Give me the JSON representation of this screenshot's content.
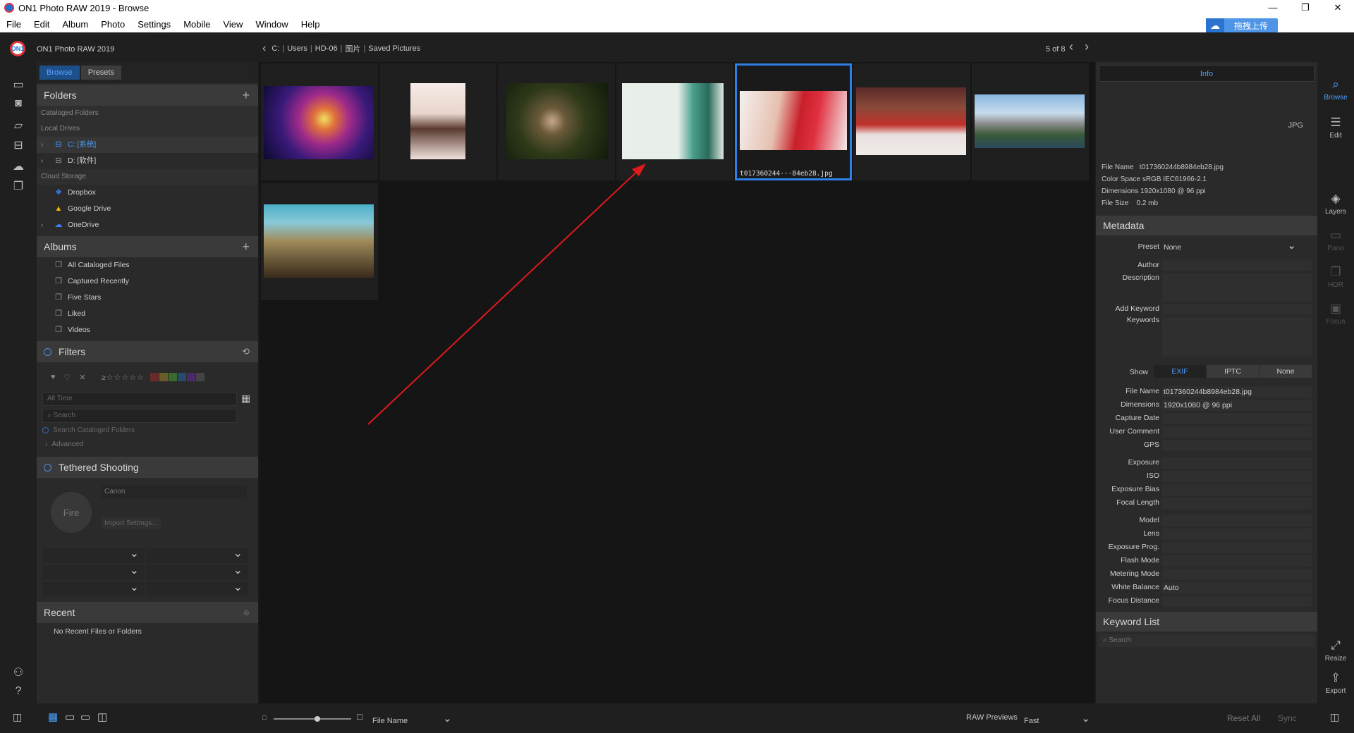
{
  "window": {
    "title": "ON1 Photo RAW 2019 - Browse",
    "controls": [
      "—",
      "❐",
      "✕"
    ]
  },
  "menu": [
    "File",
    "Edit",
    "Album",
    "Photo",
    "Settings",
    "Mobile",
    "View",
    "Window",
    "Help"
  ],
  "upload_button": "拖拽上传",
  "header": {
    "app_name": "ON1 Photo RAW 2019",
    "breadcrumb": [
      "C:",
      "Users",
      "HD-06",
      "图片",
      "Saved Pictures"
    ],
    "count": "5 of 8"
  },
  "left": {
    "tabs": [
      "Browse",
      "Presets"
    ],
    "folders": {
      "title": "Folders",
      "cataloged": "Cataloged Folders",
      "local": "Local Drives",
      "drives": [
        "C: [系统]",
        "D: [软件]"
      ],
      "cloud": "Cloud Storage",
      "cloud_items": [
        "Dropbox",
        "Google Drive",
        "OneDrive"
      ]
    },
    "albums": {
      "title": "Albums",
      "items": [
        "All Cataloged Files",
        "Captured Recently",
        "Five Stars",
        "Liked",
        "Videos"
      ]
    },
    "filters": {
      "title": "Filters",
      "stars": "≥☆☆☆☆☆",
      "time": "All Time",
      "search_placeholder": "Search",
      "search_cataloged": "Search Cataloged Folders",
      "advanced": "Advanced"
    },
    "tethered": {
      "title": "Tethered Shooting",
      "fire": "Fire",
      "camera": "Canon",
      "import": "Import Settings..."
    },
    "recent": {
      "title": "Recent",
      "empty": "No Recent Files or Folders"
    }
  },
  "grid": {
    "selected_name": "t017360244···84eb28.jpg"
  },
  "right": {
    "info_tab": "Info",
    "format": "JPG",
    "file_info": [
      {
        "k": "File Name",
        "v": "t017360244b8984eb28.jpg"
      },
      {
        "k": "Color Space",
        "v": "sRGB IEC61966-2.1"
      },
      {
        "k": "Dimensions",
        "v": "1920x1080 @ 96 ppi"
      },
      {
        "k": "File Size",
        "v": "0.2 mb"
      }
    ],
    "metadata": {
      "title": "Metadata",
      "preset_label": "Preset",
      "preset_value": "None",
      "author": "Author",
      "description": "Description",
      "add_keyword": "Add Keyword",
      "keywords": "Keywords",
      "show_label": "Show",
      "show_options": [
        "EXIF",
        "IPTC",
        "None"
      ],
      "exif": [
        {
          "k": "File Name",
          "v": "t017360244b8984eb28.jpg"
        },
        {
          "k": "Dimensions",
          "v": "1920x1080 @ 96 ppi"
        },
        {
          "k": "Capture Date",
          "v": ""
        },
        {
          "k": "User Comment",
          "v": ""
        },
        {
          "k": "GPS",
          "v": ""
        },
        {
          "k": "Exposure",
          "v": ""
        },
        {
          "k": "ISO",
          "v": ""
        },
        {
          "k": "Exposure Bias",
          "v": ""
        },
        {
          "k": "Focal Length",
          "v": ""
        },
        {
          "k": "Model",
          "v": ""
        },
        {
          "k": "Lens",
          "v": ""
        },
        {
          "k": "Exposure Prog.",
          "v": ""
        },
        {
          "k": "Flash Mode",
          "v": ""
        },
        {
          "k": "Metering Mode",
          "v": ""
        },
        {
          "k": "White Balance",
          "v": "Auto"
        },
        {
          "k": "Focus Distance",
          "v": ""
        }
      ]
    },
    "keyword_list": {
      "title": "Keyword List",
      "search": "Search"
    }
  },
  "right_strip": [
    "Browse",
    "Edit",
    "Layers",
    "Pano",
    "HDR",
    "Focus",
    "Resize",
    "Export"
  ],
  "bottom": {
    "sort_label": "File Name",
    "raw_label": "RAW Previews",
    "raw_value": "Fast",
    "reset": "Reset All",
    "sync": "Sync"
  },
  "colors": {
    "accent": "#2f7fe8",
    "panel": "#2a2a2a",
    "arrow": "#e0191c"
  }
}
